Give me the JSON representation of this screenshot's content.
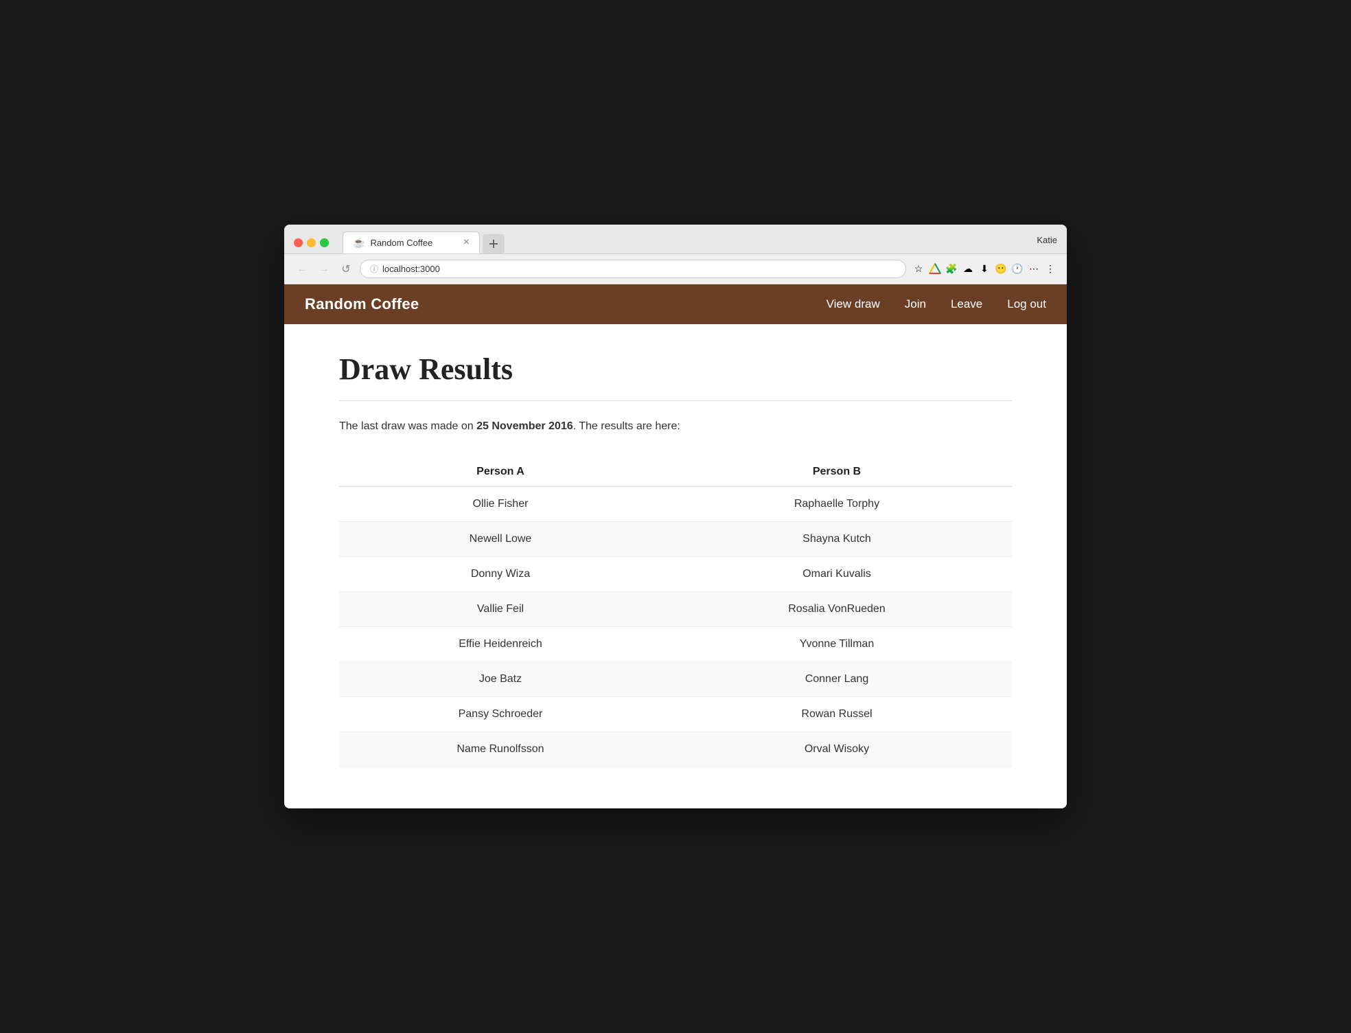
{
  "browser": {
    "url": "localhost:3000",
    "tab_title": "Random Coffee",
    "tab_favicon": "☕",
    "user": "Katie",
    "nav_back": "←",
    "nav_forward": "→",
    "nav_refresh": "↺"
  },
  "app": {
    "brand": "Random Coffee",
    "nav": {
      "view_draw": "View draw",
      "join": "Join",
      "leave": "Leave",
      "log_out": "Log out"
    }
  },
  "page": {
    "title": "Draw Results",
    "draw_info_prefix": "The last draw was made on ",
    "draw_date": "25 November 2016",
    "draw_info_suffix": ". The results are here:",
    "col_a": "Person A",
    "col_b": "Person B",
    "pairs": [
      {
        "a": "Ollie Fisher",
        "b": "Raphaelle Torphy"
      },
      {
        "a": "Newell Lowe",
        "b": "Shayna Kutch"
      },
      {
        "a": "Donny Wiza",
        "b": "Omari Kuvalis"
      },
      {
        "a": "Vallie Feil",
        "b": "Rosalia VonRueden"
      },
      {
        "a": "Effie Heidenreich",
        "b": "Yvonne Tillman"
      },
      {
        "a": "Joe Batz",
        "b": "Conner Lang"
      },
      {
        "a": "Pansy Schroeder",
        "b": "Rowan Russel"
      },
      {
        "a": "Name Runolfsson",
        "b": "Orval Wisoky"
      }
    ]
  }
}
